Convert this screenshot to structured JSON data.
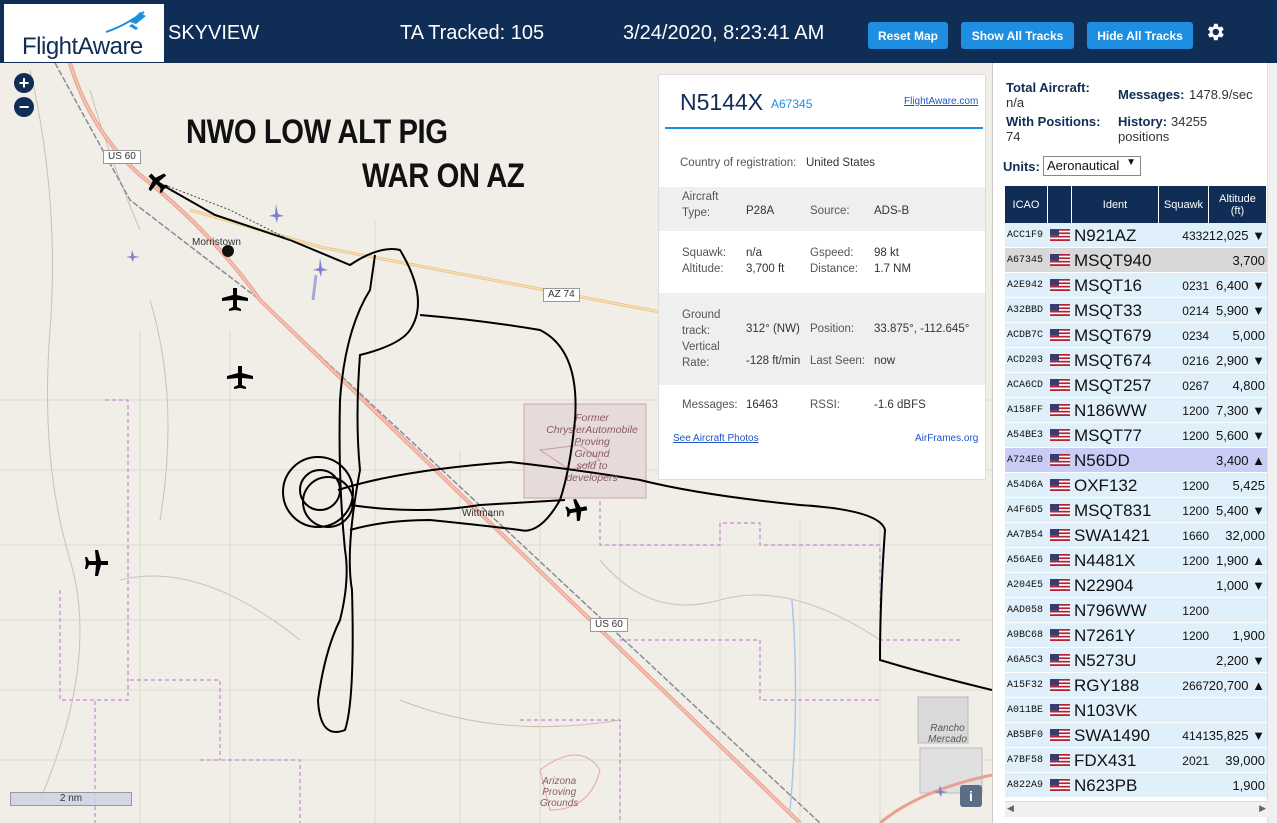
{
  "header": {
    "logo_text": "FlightAware",
    "app_name": "SKYVIEW",
    "tracked": "TA Tracked: 105",
    "datetime": "3/24/2020, 8:23:41 AM",
    "reset_label": "Reset Map",
    "show_label": "Show All Tracks",
    "hide_label": "Hide All Tracks",
    "bg_color": "#0f2d55",
    "button_color": "#1e8ee0"
  },
  "map": {
    "zoom_in": "+",
    "zoom_out": "−",
    "overlay_line1": "NWO LOW ALT PIG",
    "overlay_line2": "WAR ON AZ",
    "labels": {
      "morristown": "Morristown",
      "wittmann": "Wittmann",
      "proving1": "Former\nChryslerAutomobile\nProving\nGround\nsold to\ndevelopers",
      "rancho": "Rancho\nMercado",
      "arizona": "Arizona\nProving\nGrounds"
    },
    "shields": {
      "us60_top": "US 60",
      "az74": "AZ 74",
      "us60_bottom": "US 60"
    },
    "scale": "2 nm",
    "info": "i"
  },
  "popup": {
    "callsign": "N5144X",
    "icao": "A67345",
    "fa_link": "FlightAware.com",
    "country_label": "Country of registration:",
    "country_value": "United States",
    "aircraft_type_label": "Aircraft\nType:",
    "aircraft_type_value": "P28A",
    "source_label": "Source:",
    "source_value": "ADS-B",
    "squawk_label": "Squawk:",
    "squawk_value": "n/a",
    "gspeed_label": "Gspeed:",
    "gspeed_value": "98 kt",
    "altitude_label": "Altitude:",
    "altitude_value": "3,700 ft",
    "distance_label": "Distance:",
    "distance_value": "1.7 NM",
    "gtrack_label": "Ground\ntrack:\nVertical\nRate:",
    "gtrack_value": "312° (NW)",
    "vrate_value": "-128 ft/min",
    "position_label": "Position:",
    "position_value": "33.875°, -112.645°",
    "lastseen_label": "Last Seen:",
    "lastseen_value": "now",
    "messages_label": "Messages:",
    "messages_value": "16463",
    "rssi_label": "RSSI:",
    "rssi_value": "-1.6 dBFS",
    "photos_link": "See Aircraft Photos",
    "airframes_link": "AirFrames.org"
  },
  "sidebar": {
    "total_label": "Total Aircraft:",
    "total_value": "n/a",
    "messages_label": "Messages:",
    "messages_value": "1478.9/sec",
    "withpos_label": "With Positions:",
    "withpos_value": "74",
    "history_label": "History:",
    "history_value": "34255",
    "history_unit": "positions",
    "units_label": "Units:",
    "units_value": "Aeronautical",
    "columns": {
      "icao": "ICAO",
      "ident": "Ident",
      "squawk": "Squawk",
      "altitude": "Altitude\n(ft)"
    },
    "rows": [
      {
        "icao": "ACC1F9",
        "ident": "N921AZ",
        "squawk": "4332",
        "alt": "12,025 ▼",
        "hl": ""
      },
      {
        "icao": "A67345",
        "ident": "MSQT940",
        "squawk": "",
        "alt": "3,700",
        "hl": "sel"
      },
      {
        "icao": "A2E942",
        "ident": "MSQT16",
        "squawk": "0231",
        "alt": "6,400 ▼",
        "hl": ""
      },
      {
        "icao": "A32BBD",
        "ident": "MSQT33",
        "squawk": "0214",
        "alt": "5,900 ▼",
        "hl": ""
      },
      {
        "icao": "ACDB7C",
        "ident": "MSQT679",
        "squawk": "0234",
        "alt": "5,000",
        "hl": ""
      },
      {
        "icao": "ACD203",
        "ident": "MSQT674",
        "squawk": "0216",
        "alt": "2,900 ▼",
        "hl": ""
      },
      {
        "icao": "ACA6CD",
        "ident": "MSQT257",
        "squawk": "0267",
        "alt": "4,800",
        "hl": ""
      },
      {
        "icao": "A158FF",
        "ident": "N186WW",
        "squawk": "1200",
        "alt": "7,300 ▼",
        "hl": ""
      },
      {
        "icao": "A54BE3",
        "ident": "MSQT77",
        "squawk": "1200",
        "alt": "5,600 ▼",
        "hl": ""
      },
      {
        "icao": "A724E0",
        "ident": "N56DD",
        "squawk": "",
        "alt": "3,400 ▲",
        "hl": "hover"
      },
      {
        "icao": "A54D6A",
        "ident": "OXF132",
        "squawk": "1200",
        "alt": "5,425",
        "hl": ""
      },
      {
        "icao": "A4F6D5",
        "ident": "MSQT831",
        "squawk": "1200",
        "alt": "5,400 ▼",
        "hl": ""
      },
      {
        "icao": "AA7B54",
        "ident": "SWA1421",
        "squawk": "1660",
        "alt": "32,000",
        "hl": ""
      },
      {
        "icao": "A56AE6",
        "ident": "N4481X",
        "squawk": "1200",
        "alt": "1,900 ▲",
        "hl": ""
      },
      {
        "icao": "A204E5",
        "ident": "N22904",
        "squawk": "",
        "alt": "1,000 ▼",
        "hl": ""
      },
      {
        "icao": "AAD058",
        "ident": "N796WW",
        "squawk": "1200",
        "alt": "",
        "hl": ""
      },
      {
        "icao": "A9BC68",
        "ident": "N7261Y",
        "squawk": "1200",
        "alt": "1,900",
        "hl": ""
      },
      {
        "icao": "A6A5C3",
        "ident": "N5273U",
        "squawk": "",
        "alt": "2,200 ▼",
        "hl": ""
      },
      {
        "icao": "A15F32",
        "ident": "RGY188",
        "squawk": "2667",
        "alt": "20,700 ▲",
        "hl": ""
      },
      {
        "icao": "A011BE",
        "ident": "N103VK",
        "squawk": "",
        "alt": "",
        "hl": ""
      },
      {
        "icao": "AB5BF0",
        "ident": "SWA1490",
        "squawk": "4141",
        "alt": "35,825 ▼",
        "hl": ""
      },
      {
        "icao": "A7BF58",
        "ident": "FDX431",
        "squawk": "2021",
        "alt": "39,000",
        "hl": ""
      },
      {
        "icao": "A822A9",
        "ident": "N623PB",
        "squawk": "",
        "alt": "1,900",
        "hl": ""
      }
    ]
  }
}
